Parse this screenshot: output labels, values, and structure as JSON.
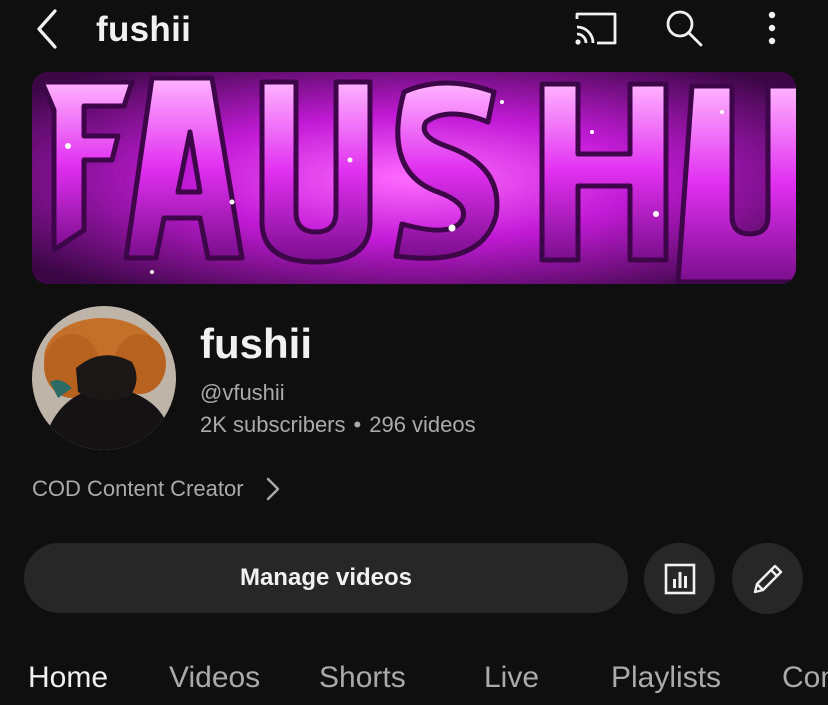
{
  "topbar": {
    "title": "fushii",
    "icons": [
      "back-arrow-icon",
      "cast-icon",
      "search-icon",
      "more-vertical-icon"
    ]
  },
  "channel": {
    "name": "fushii",
    "handle": "@vfushii",
    "subscribers": "2K subscribers",
    "separator": "•",
    "videos": "296 videos",
    "description": "COD Content Creator"
  },
  "actions": {
    "manage_label": "Manage videos",
    "icons": [
      "analytics-icon",
      "edit-pencil-icon"
    ]
  },
  "tabs": [
    {
      "label": "Home",
      "active": true
    },
    {
      "label": "Videos",
      "active": false
    },
    {
      "label": "Shorts",
      "active": false
    },
    {
      "label": "Live",
      "active": false
    },
    {
      "label": "Playlists",
      "active": false
    },
    {
      "label": "Community",
      "active": false
    }
  ],
  "colors": {
    "background": "#0f0f0f",
    "text_primary": "#f1f1f1",
    "text_secondary": "#aaaaaa",
    "button_bg": "#272727",
    "banner_accent": "#e24bf0"
  }
}
